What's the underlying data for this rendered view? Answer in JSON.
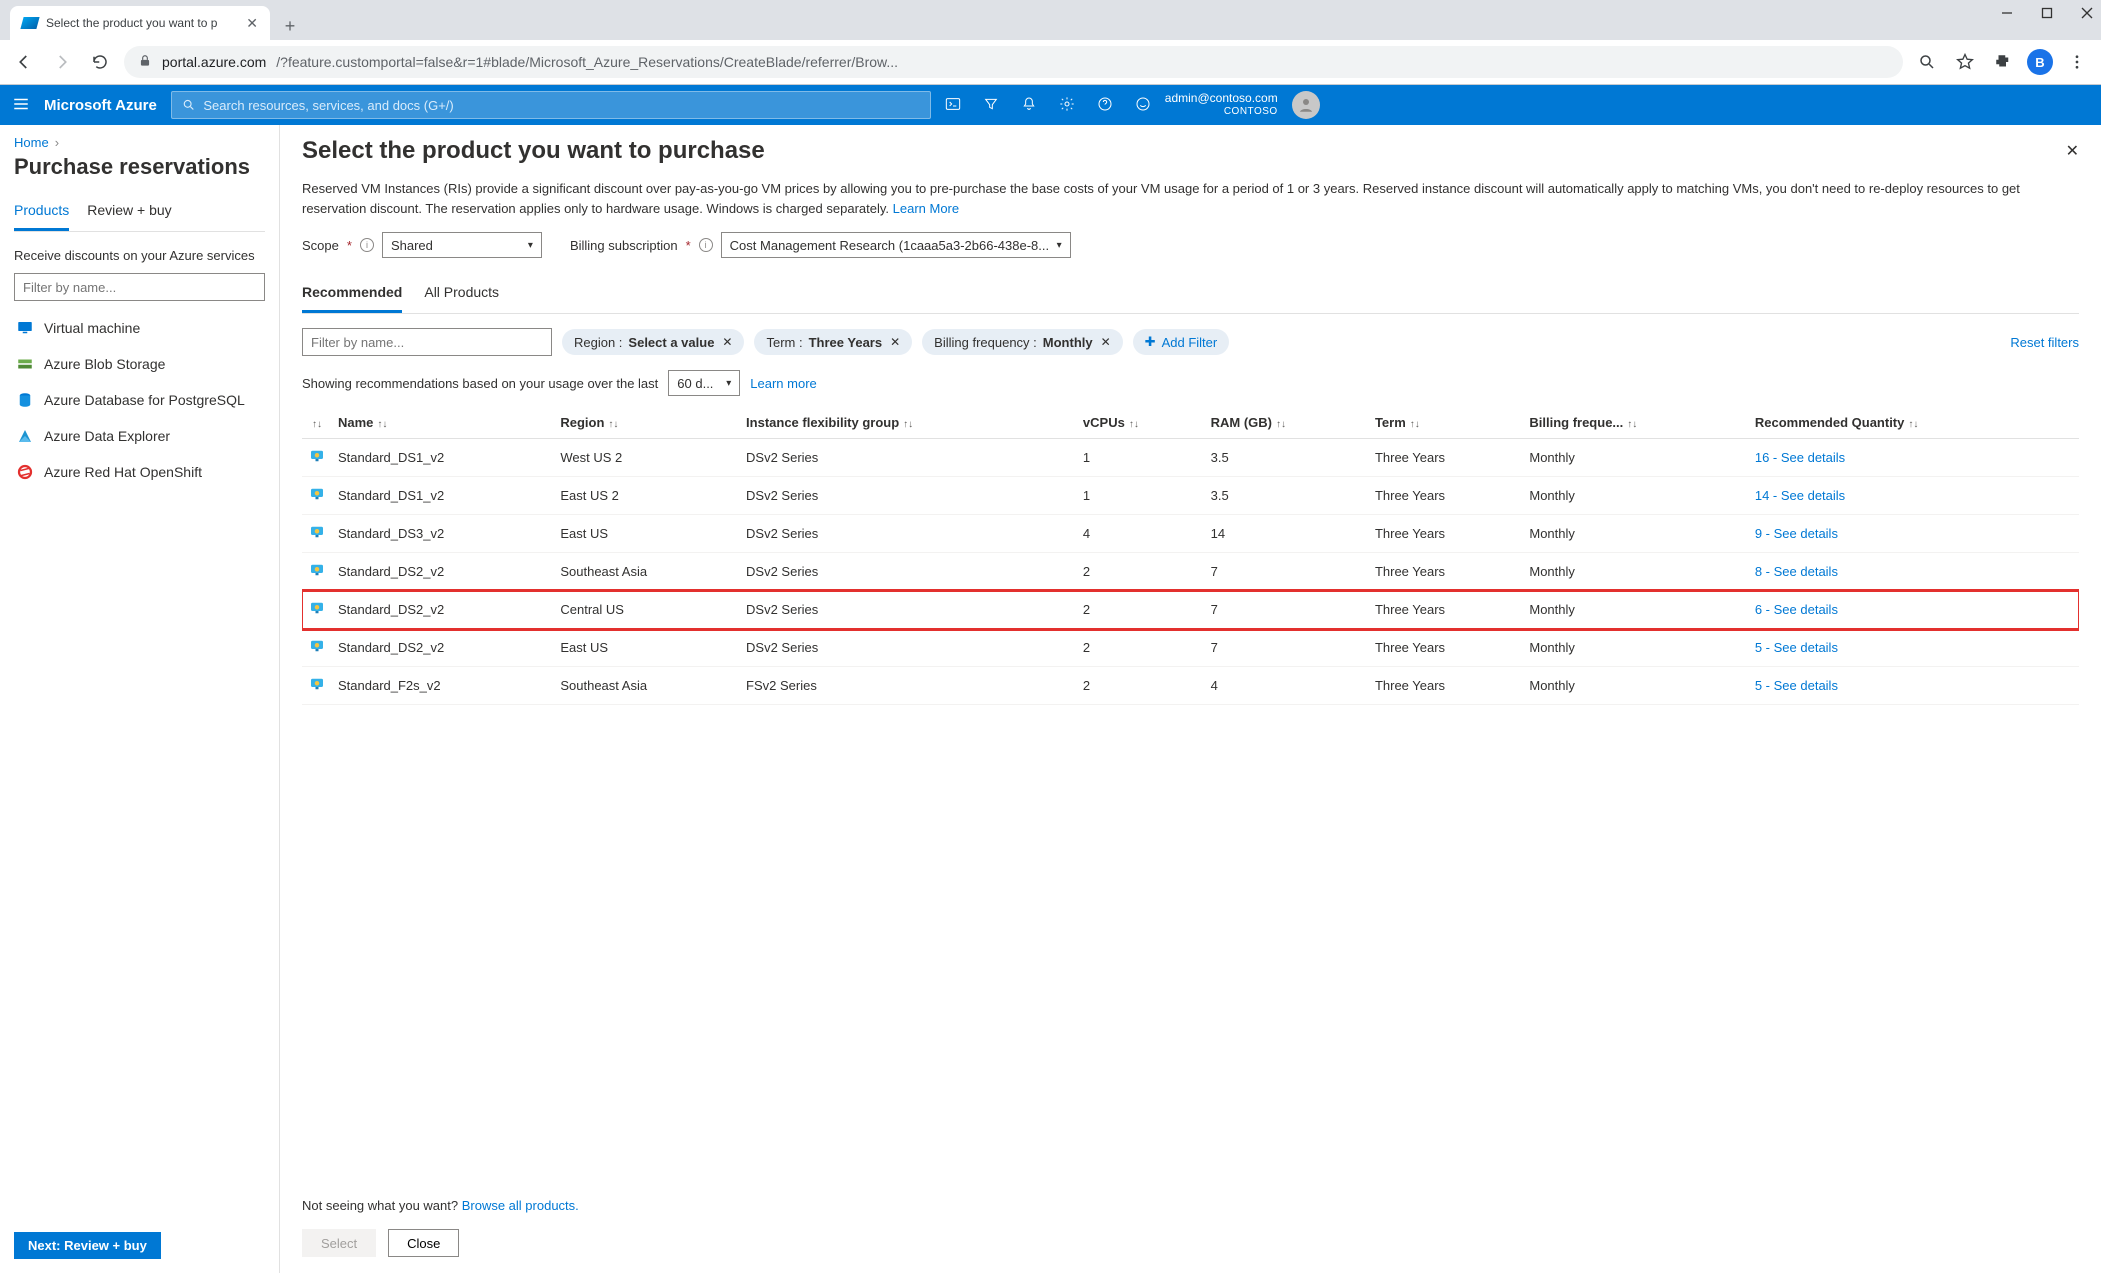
{
  "browser": {
    "tab_title": "Select the product you want to p",
    "url_host": "portal.azure.com",
    "url_rest": "/?feature.customportal=false&r=1#blade/Microsoft_Azure_Reservations/CreateBlade/referrer/Brow...",
    "profile_initial": "B"
  },
  "azure_bar": {
    "brand": "Microsoft Azure",
    "search_placeholder": "Search resources, services, and docs (G+/)",
    "account_email": "admin@contoso.com",
    "tenant": "CONTOSO"
  },
  "left_pane": {
    "breadcrumb_home": "Home",
    "title": "Purchase reservations",
    "tabs": {
      "products": "Products",
      "review": "Review + buy"
    },
    "description": "Receive discounts on your Azure services",
    "filter_placeholder": "Filter by name...",
    "services": [
      {
        "label": "Virtual machine",
        "icon": "vm"
      },
      {
        "label": "Azure Blob Storage",
        "icon": "blob"
      },
      {
        "label": "Azure Database for PostgreSQL",
        "icon": "pg"
      },
      {
        "label": "Azure Data Explorer",
        "icon": "adx"
      },
      {
        "label": "Azure Red Hat OpenShift",
        "icon": "aro"
      }
    ],
    "footer_button": "Next: Review + buy"
  },
  "blade": {
    "title": "Select the product you want to purchase",
    "description": "Reserved VM Instances (RIs) provide a significant discount over pay-as-you-go VM prices by allowing you to pre-purchase the base costs of your VM usage for a period of 1 or 3 years. Reserved instance discount will automatically apply to matching VMs, you don't need to re-deploy resources to get reservation discount. The reservation applies only to hardware usage. Windows is charged separately. ",
    "learn_more": "Learn More",
    "scope_label": "Scope",
    "scope_value": "Shared",
    "billing_sub_label": "Billing subscription",
    "billing_sub_value": "Cost Management Research (1caaa5a3-2b66-438e-8...",
    "sub_tabs": {
      "recommended": "Recommended",
      "all": "All Products"
    },
    "filter_placeholder": "Filter by name...",
    "pills": {
      "region_key": "Region : ",
      "region_val": "Select a value",
      "term_key": "Term : ",
      "term_val": "Three Years",
      "billing_key": "Billing frequency : ",
      "billing_val": "Monthly",
      "add_filter": "Add Filter"
    },
    "reset_filters": "Reset filters",
    "usage_prefix": "Showing recommendations based on your usage over the last",
    "usage_period": "60 d...",
    "usage_learn": "Learn more",
    "columns": {
      "name": "Name",
      "region": "Region",
      "flex": "Instance flexibility group",
      "vcpus": "vCPUs",
      "ram": "RAM (GB)",
      "term": "Term",
      "billing": "Billing freque...",
      "rec": "Recommended Quantity"
    },
    "rows": [
      {
        "name": "Standard_DS1_v2",
        "region": "West US 2",
        "flex": "DSv2 Series",
        "vcpus": "1",
        "ram": "3.5",
        "term": "Three Years",
        "billing": "Monthly",
        "rec": "16 - See details",
        "highlight": false
      },
      {
        "name": "Standard_DS1_v2",
        "region": "East US 2",
        "flex": "DSv2 Series",
        "vcpus": "1",
        "ram": "3.5",
        "term": "Three Years",
        "billing": "Monthly",
        "rec": "14 - See details",
        "highlight": false
      },
      {
        "name": "Standard_DS3_v2",
        "region": "East US",
        "flex": "DSv2 Series",
        "vcpus": "4",
        "ram": "14",
        "term": "Three Years",
        "billing": "Monthly",
        "rec": "9 - See details",
        "highlight": false
      },
      {
        "name": "Standard_DS2_v2",
        "region": "Southeast Asia",
        "flex": "DSv2 Series",
        "vcpus": "2",
        "ram": "7",
        "term": "Three Years",
        "billing": "Monthly",
        "rec": "8 - See details",
        "highlight": false
      },
      {
        "name": "Standard_DS2_v2",
        "region": "Central US",
        "flex": "DSv2 Series",
        "vcpus": "2",
        "ram": "7",
        "term": "Three Years",
        "billing": "Monthly",
        "rec": "6 - See details",
        "highlight": true
      },
      {
        "name": "Standard_DS2_v2",
        "region": "East US",
        "flex": "DSv2 Series",
        "vcpus": "2",
        "ram": "7",
        "term": "Three Years",
        "billing": "Monthly",
        "rec": "5 - See details",
        "highlight": false
      },
      {
        "name": "Standard_F2s_v2",
        "region": "Southeast Asia",
        "flex": "FSv2 Series",
        "vcpus": "2",
        "ram": "4",
        "term": "Three Years",
        "billing": "Monthly",
        "rec": "5 - See details",
        "highlight": false
      }
    ],
    "browse_prefix": "Not seeing what you want? ",
    "browse_link": "Browse all products.",
    "footer": {
      "select": "Select",
      "close": "Close"
    }
  }
}
